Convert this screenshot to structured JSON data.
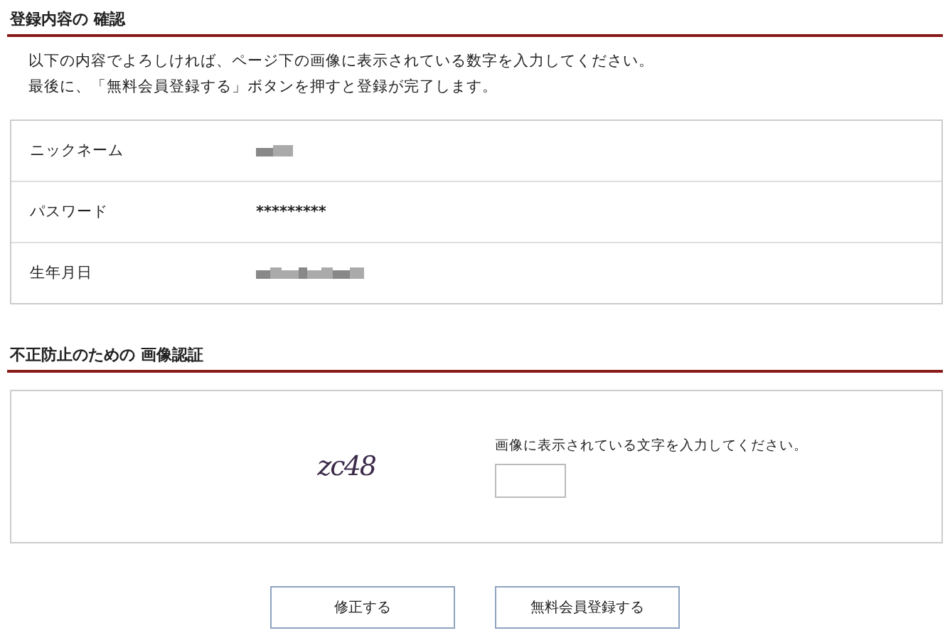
{
  "sections": [
    {
      "title": "登録内容の 確認"
    },
    {
      "title": "不正防止のための 画像認証"
    }
  ],
  "intro": [
    "以下の内容でよろしければ、ページ下の画像に表示されている数字を入力してください。",
    "最後に、「無料会員登録する」ボタンを押すと登録が完了します。"
  ],
  "fields": [
    {
      "label": "ニックネーム",
      "kind": "redacted"
    },
    {
      "label": "パスワード",
      "kind": "text",
      "value": "*********"
    },
    {
      "label": "生年月日",
      "kind": "redacted"
    }
  ],
  "captcha": {
    "code": "zc48",
    "instruction": "画像に表示されている文字を入力してください。"
  },
  "buttons": [
    "修正する",
    "無料会員登録する"
  ]
}
